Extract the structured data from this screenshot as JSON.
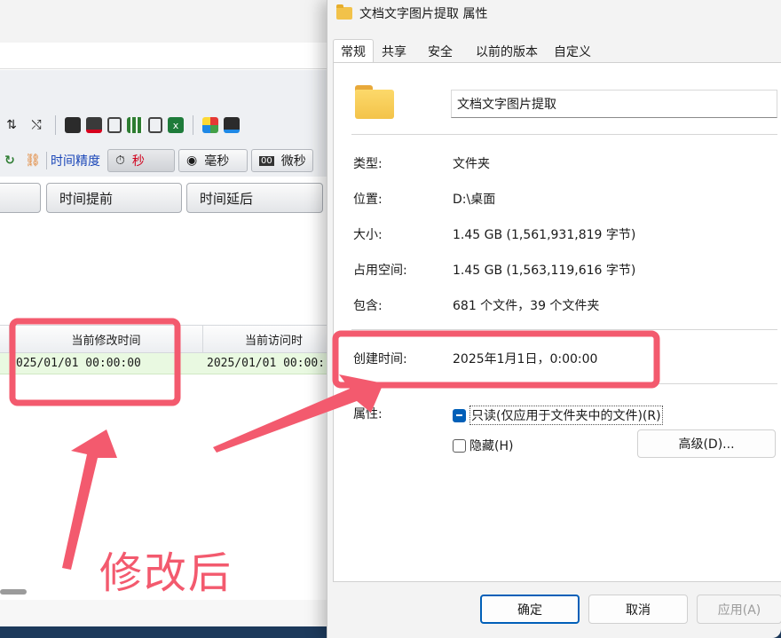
{
  "background_app": {
    "toolbar": {
      "precision_label": "时间精度",
      "seconds_label": "秒",
      "milliseconds_label": "毫秒",
      "microseconds_label": "微秒"
    },
    "buttons": {
      "advance_label": "时间提前",
      "delay_label": "时间延后"
    },
    "grid": {
      "columns": [
        "当前修改时间",
        "当前访问时"
      ],
      "row": [
        "025/01/01 00:00:00",
        "2025/01/01 00:00:"
      ]
    }
  },
  "dialog": {
    "title": "文档文字图片提取 属性",
    "tabs": [
      "常规",
      "共享",
      "安全",
      "以前的版本",
      "自定义"
    ],
    "active_tab": "常规",
    "name": "文档文字图片提取",
    "properties": {
      "type_label": "类型:",
      "type_value": "文件夹",
      "location_label": "位置:",
      "location_value": "D:\\桌面",
      "size_label": "大小:",
      "size_value": "1.45 GB (1,561,931,819 字节)",
      "disk_size_label": "占用空间:",
      "disk_size_value": "1.45 GB (1,563,119,616 字节)",
      "contains_label": "包含:",
      "contains_value": "681 个文件，39 个文件夹",
      "created_label": "创建时间:",
      "created_value": "2025年1月1日，0:00:00"
    },
    "attributes": {
      "label": "属性:",
      "readonly_label": "只读(仅应用于文件夹中的文件)(R)",
      "hidden_label": "隐藏(H)",
      "advanced_label": "高级(D)..."
    },
    "footer": {
      "ok_label": "确定",
      "cancel_label": "取消",
      "apply_label": "应用(A)"
    }
  },
  "annotation": {
    "text": "修改后",
    "color": "#f35a6e"
  }
}
